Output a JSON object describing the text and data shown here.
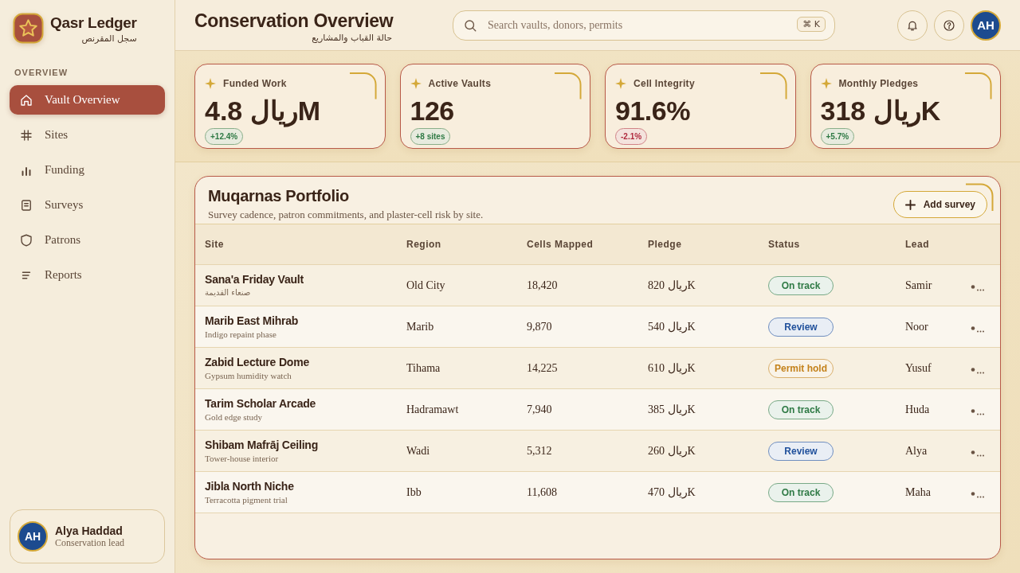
{
  "sidebar": {
    "brand": {
      "name": "Qasr Ledger",
      "subtitle": "سجل المقرنص"
    },
    "section_label": "OVERVIEW",
    "items": [
      {
        "label": "Vault Overview",
        "selected": true
      },
      {
        "label": "Sites",
        "selected": false
      },
      {
        "label": "Funding",
        "selected": false
      },
      {
        "label": "Surveys",
        "selected": false
      },
      {
        "label": "Patrons",
        "selected": false
      },
      {
        "label": "Reports",
        "selected": false
      }
    ],
    "user": {
      "initials": "AH",
      "name": "Alya Haddad",
      "role": "Conservation lead"
    }
  },
  "header": {
    "title": "Conservation Overview",
    "subtitle": "حالة القباب والمشاريع",
    "search": {
      "placeholder": "Search vaults, donors, permits",
      "shortcut": "⌘ K"
    },
    "avatar": "AH"
  },
  "stats": [
    {
      "label": "Funded Work",
      "value": "ريال 4.8M",
      "delta": {
        "text": "+12.4%",
        "color": "#2f7a45"
      }
    },
    {
      "label": "Active Vaults",
      "value": "126",
      "delta": {
        "text": "+8 sites",
        "color": "#2f7a45"
      }
    },
    {
      "label": "Cell Integrity",
      "value": "91.6%",
      "delta": {
        "text": "-2.1%",
        "color": "#b02a3e"
      }
    },
    {
      "label": "Monthly Pledges",
      "value": "ريال 318K",
      "delta": {
        "text": "+5.7%",
        "color": "#2f7a45"
      }
    }
  ],
  "portfolio": {
    "title": "Muqarnas Portfolio",
    "description": "Survey cadence, patron commitments, and plaster-cell risk by site.",
    "add_button": "Add survey",
    "columns": [
      "Site",
      "Region",
      "Cells Mapped",
      "Pledge",
      "Status",
      "Lead"
    ],
    "rows": [
      {
        "site": "Sana'a Friday Vault",
        "note": "صنعاء القديمة",
        "region": "Old City",
        "cells": "18,420",
        "pledge": "ريال 820K",
        "status": {
          "label": "On track",
          "color": "#2f7a45"
        },
        "lead": "Samir"
      },
      {
        "site": "Marib East Mihrab",
        "note": "Indigo repaint phase",
        "region": "Marib",
        "cells": "9,870",
        "pledge": "ريال 540K",
        "status": {
          "label": "Review",
          "color": "#21519c"
        },
        "lead": "Noor"
      },
      {
        "site": "Zabid Lecture Dome",
        "note": "Gypsum humidity watch",
        "region": "Tihama",
        "cells": "14,225",
        "pledge": "ريال 610K",
        "status": {
          "label": "Permit hold",
          "color": "#c4821c"
        },
        "lead": "Yusuf"
      },
      {
        "site": "Tarim Scholar Arcade",
        "note": "Gold edge study",
        "region": "Hadramawt",
        "cells": "7,940",
        "pledge": "ريال 385K",
        "status": {
          "label": "On track",
          "color": "#2f7a45"
        },
        "lead": "Huda"
      },
      {
        "site": "Shibam Mafrāj Ceiling",
        "note": "Tower-house interior",
        "region": "Wadi",
        "cells": "5,312",
        "pledge": "ريال 260K",
        "status": {
          "label": "Review",
          "color": "#21519c"
        },
        "lead": "Alya"
      },
      {
        "site": "Jibla North Niche",
        "note": "Terracotta pigment trial",
        "region": "Ibb",
        "cells": "11,608",
        "pledge": "ريال 470K",
        "status": {
          "label": "On track",
          "color": "#2f7a45"
        },
        "lead": "Maha"
      }
    ]
  }
}
